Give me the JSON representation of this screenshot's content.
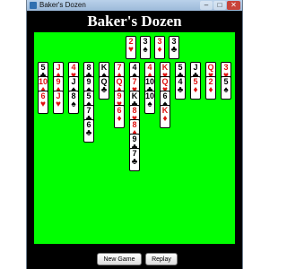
{
  "window": {
    "title": "Baker's Dozen"
  },
  "header": {
    "title": "Baker's Dozen"
  },
  "foundations": [
    {
      "rank": "2",
      "suit": "♥",
      "color": "red"
    },
    {
      "rank": "3",
      "suit": "♠",
      "color": "black"
    },
    {
      "rank": "3",
      "suit": "♦",
      "color": "red"
    },
    {
      "rank": "3",
      "suit": "♣",
      "color": "black"
    }
  ],
  "tableau": [
    [
      {
        "rank": "5",
        "suit": "♣",
        "color": "black"
      },
      {
        "rank": "10",
        "suit": "♦",
        "color": "red"
      },
      {
        "rank": "6",
        "suit": "♥",
        "color": "red"
      }
    ],
    [
      {
        "rank": "J",
        "suit": "♦",
        "color": "red"
      },
      {
        "rank": "9",
        "suit": "♦",
        "color": "red"
      },
      {
        "rank": "J",
        "suit": "♥",
        "color": "red"
      }
    ],
    [
      {
        "rank": "4",
        "suit": "♥",
        "color": "red"
      },
      {
        "rank": "J",
        "suit": "♠",
        "color": "black"
      },
      {
        "rank": "8",
        "suit": "♠",
        "color": "black"
      }
    ],
    [
      {
        "rank": "8",
        "suit": "♣",
        "color": "black"
      },
      {
        "rank": "9",
        "suit": "♠",
        "color": "black"
      },
      {
        "rank": "5",
        "suit": "♠",
        "color": "black"
      },
      {
        "rank": "7",
        "suit": "♣",
        "color": "black"
      },
      {
        "rank": "6",
        "suit": "♣",
        "color": "black"
      }
    ],
    [
      {
        "rank": "K",
        "suit": "♠",
        "color": "black"
      },
      {
        "rank": "Q",
        "suit": "♣",
        "color": "black"
      }
    ],
    [
      {
        "rank": "7",
        "suit": "♦",
        "color": "red"
      },
      {
        "rank": "Q",
        "suit": "♦",
        "color": "red"
      },
      {
        "rank": "9",
        "suit": "♥",
        "color": "red"
      },
      {
        "rank": "6",
        "suit": "♦",
        "color": "red"
      }
    ],
    [
      {
        "rank": "4",
        "suit": "♠",
        "color": "black"
      },
      {
        "rank": "7",
        "suit": "♥",
        "color": "red"
      },
      {
        "rank": "K",
        "suit": "♣",
        "color": "black"
      },
      {
        "rank": "8",
        "suit": "♥",
        "color": "red"
      },
      {
        "rank": "8",
        "suit": "♦",
        "color": "red"
      },
      {
        "rank": "9",
        "suit": "♣",
        "color": "black"
      },
      {
        "rank": "7",
        "suit": "♣",
        "color": "black"
      }
    ],
    [
      {
        "rank": "4",
        "suit": "♦",
        "color": "red"
      },
      {
        "rank": "10",
        "suit": "♣",
        "color": "black"
      },
      {
        "rank": "10",
        "suit": "♠",
        "color": "black"
      }
    ],
    [
      {
        "rank": "K",
        "suit": "♥",
        "color": "red"
      },
      {
        "rank": "Q",
        "suit": "♥",
        "color": "red"
      },
      {
        "rank": "6",
        "suit": "♠",
        "color": "black"
      },
      {
        "rank": "K",
        "suit": "♦",
        "color": "red"
      }
    ],
    [
      {
        "rank": "5",
        "suit": "♣",
        "color": "black"
      },
      {
        "rank": "4",
        "suit": "♣",
        "color": "black"
      }
    ],
    [
      {
        "rank": "J",
        "suit": "♣",
        "color": "black"
      },
      {
        "rank": "5",
        "suit": "♦",
        "color": "red"
      }
    ],
    [
      {
        "rank": "Q",
        "suit": "♥",
        "color": "red"
      },
      {
        "rank": "2",
        "suit": "♦",
        "color": "red"
      }
    ],
    [
      {
        "rank": "3",
        "suit": "♥",
        "color": "red"
      },
      {
        "rank": "5",
        "suit": "♠",
        "color": "black"
      }
    ]
  ],
  "buttons": {
    "new_game": "New Game",
    "replay": "Replay"
  },
  "colors": {
    "felt": "#00ff00",
    "background": "#000000",
    "red_suit": "#e01010"
  }
}
